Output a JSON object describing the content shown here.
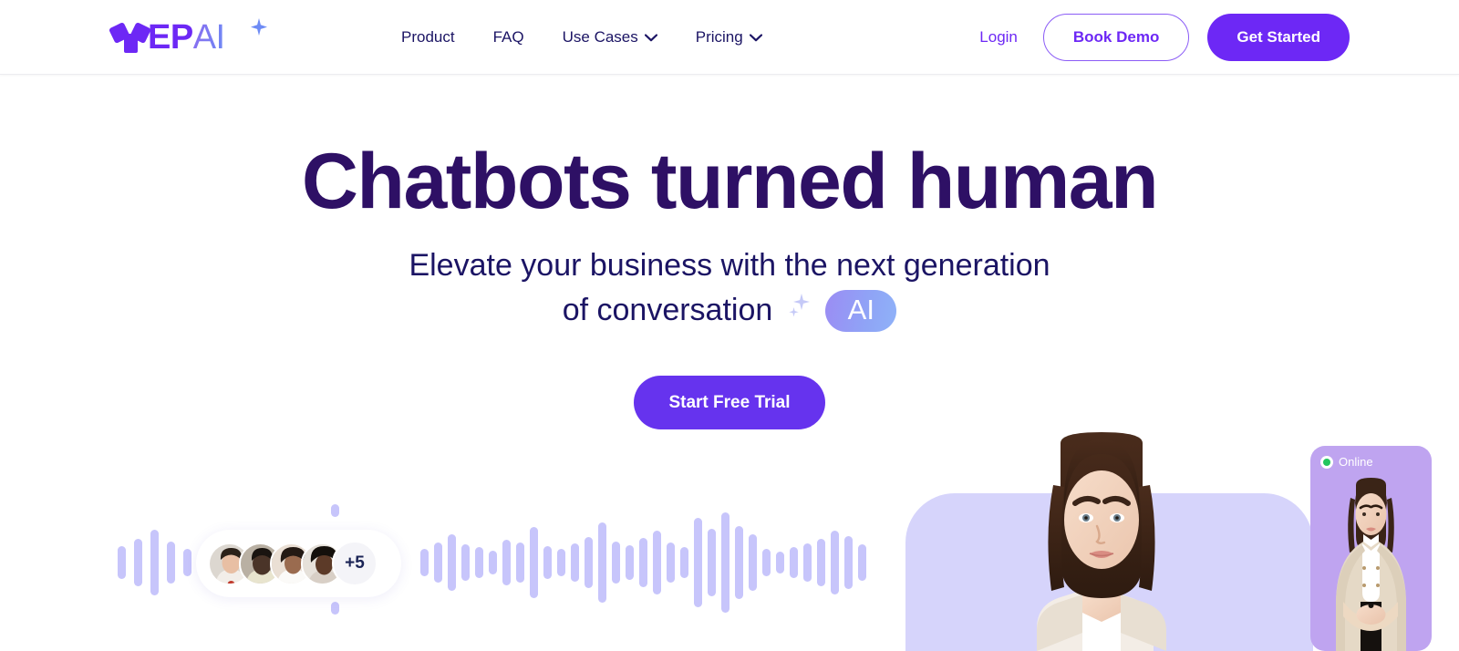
{
  "header": {
    "logo": {
      "mark_icon": "yep-logo-mark-icon",
      "text_ep": "EP",
      "text_ai": "AI",
      "sparkle_icon": "sparkle-icon"
    },
    "nav": [
      {
        "label": "Product",
        "has_chevron": false
      },
      {
        "label": "FAQ",
        "has_chevron": false
      },
      {
        "label": "Use Cases",
        "has_chevron": true
      },
      {
        "label": "Pricing",
        "has_chevron": true
      }
    ],
    "login_label": "Login",
    "book_demo_label": "Book Demo",
    "get_started_label": "Get Started"
  },
  "hero": {
    "title": "Chatbots turned human",
    "subtitle_line1": "Elevate your business with the next generation",
    "subtitle_line2": "of conversation",
    "ai_badge": "AI",
    "sparkle_icon": "sparkles-icon",
    "cta_label": "Start Free Trial"
  },
  "social_proof": {
    "avatar_count_label": "+5",
    "avatars": [
      {
        "name": "avatar-1"
      },
      {
        "name": "avatar-2"
      },
      {
        "name": "avatar-3"
      },
      {
        "name": "avatar-4"
      }
    ]
  },
  "agent_card": {
    "status_label": "Online",
    "status_color": "#22C55E",
    "card_color": "#BFA4F0"
  },
  "colors": {
    "brand_purple": "#6D28F5",
    "cta_purple": "#6633EE",
    "heading_purple": "#2E1065",
    "nav_navy": "#1B1464",
    "wave_periwinkle": "#C7C5FB",
    "shape_periwinkle": "#D6D4FB"
  },
  "waveform": {
    "left_group_heights": [
      36,
      52,
      72,
      46,
      30
    ],
    "right_group_heights": [
      30,
      44,
      62,
      40,
      34,
      26,
      50,
      44,
      78,
      36,
      30,
      42,
      56,
      88,
      46,
      38,
      54,
      70,
      44,
      34,
      98,
      74,
      110,
      80,
      62,
      30,
      24,
      34,
      42,
      52,
      70,
      58,
      40
    ]
  }
}
